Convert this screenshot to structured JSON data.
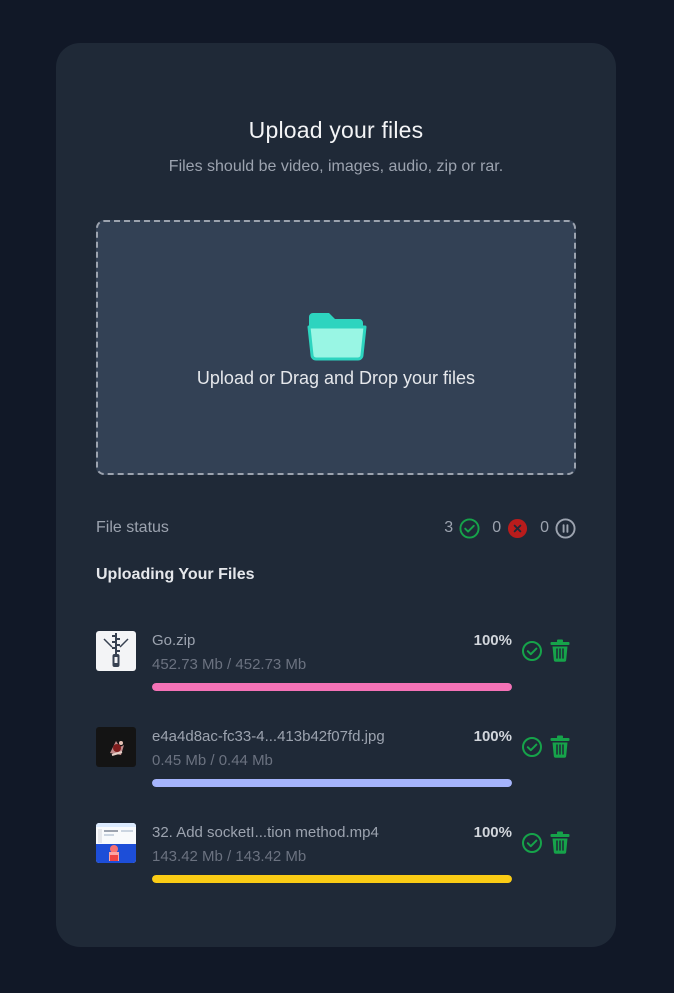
{
  "header": {
    "title": "Upload your files",
    "subtitle": "Files should be video, images, audio, zip or rar."
  },
  "dropzone": {
    "label": "Upload or Drag and Drop your files",
    "icon": "folder-open-icon",
    "icon_color": "#5eead4"
  },
  "status": {
    "label": "File status",
    "completed": "3",
    "failed": "0",
    "paused": "0",
    "completed_color": "#16a34a",
    "failed_color": "#dc2626",
    "paused_color": "#9ca3af"
  },
  "uploads": {
    "title": "Uploading Your Files",
    "files": [
      {
        "name": "Go.zip",
        "size": "452.73 Mb / 452.73 Mb",
        "percent_label": "100%",
        "progress": 1.0,
        "bar_color": "#f472b6",
        "thumb": "zip-file-icon"
      },
      {
        "name": "e4a4d8ac-fc33-4...413b42f07fd.jpg",
        "size": "0.45 Mb / 0.44 Mb",
        "percent_label": "100%",
        "progress": 1.0,
        "bar_color": "#a5b4fc",
        "thumb": "image-thumbnail"
      },
      {
        "name": "32. Add socketI...tion method.mp4",
        "size": "143.42 Mb / 143.42 Mb",
        "percent_label": "100%",
        "progress": 1.0,
        "bar_color": "#facc15",
        "thumb": "video-thumbnail"
      }
    ]
  },
  "colors": {
    "background": "#111827",
    "card": "#1f2937",
    "success": "#16a34a"
  }
}
